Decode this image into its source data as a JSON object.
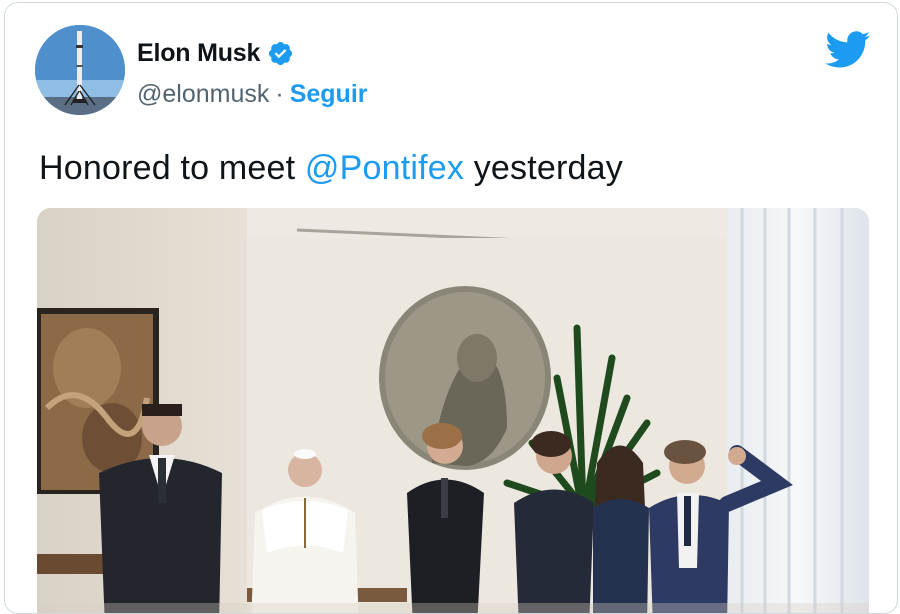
{
  "tweet": {
    "author_name": "Elon Musk",
    "handle": "@elonmusk",
    "separator": "·",
    "follow_label": "Seguir",
    "text_before": "Honored to meet ",
    "mention": "@Pontifex",
    "text_after": " yesterday"
  },
  "icons": {
    "verified": "verified-badge-icon",
    "logo": "twitter-bird-icon"
  },
  "colors": {
    "accent": "#1d9bf0",
    "text": "#0f1419",
    "secondary": "#536471",
    "border": "#cfd9de"
  }
}
